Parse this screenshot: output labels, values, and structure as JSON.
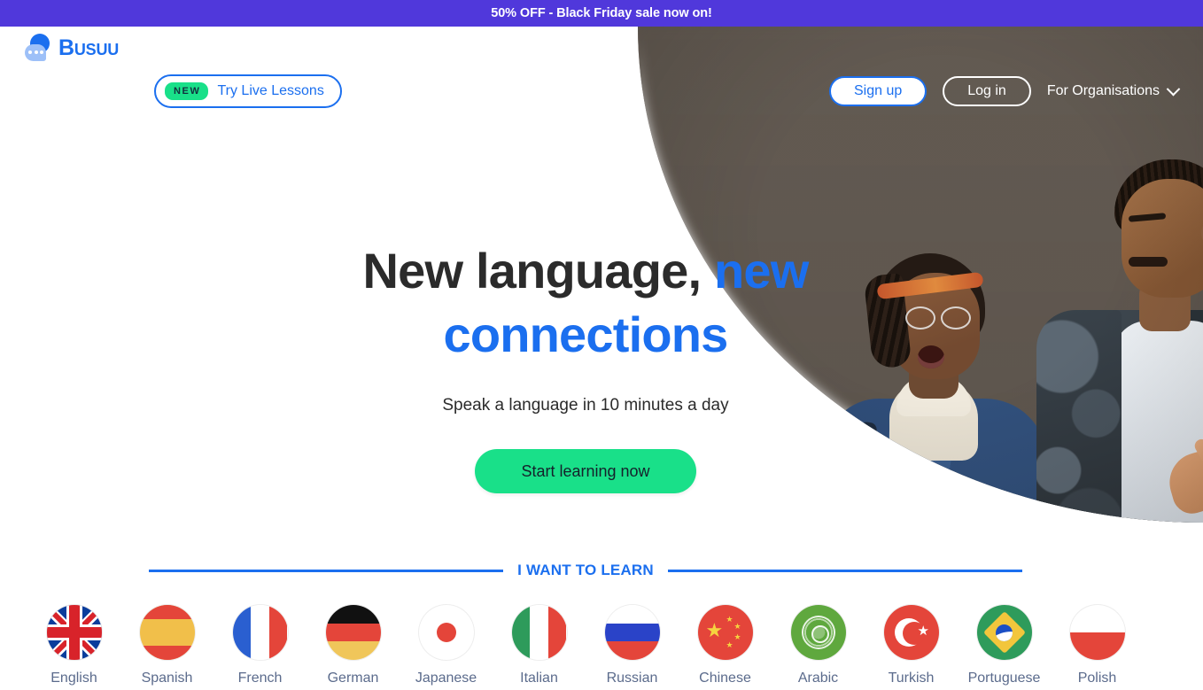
{
  "promo": {
    "text": "50% OFF - Black Friday sale now on!",
    "background": "#5038DB"
  },
  "header": {
    "brand_name": "Busuu",
    "brand_icon": "busuu-speech-bubble-logo",
    "live_lessons": {
      "badge": "NEW",
      "label": "Try Live Lessons"
    },
    "signup_label": "Sign up",
    "login_label": "Log in",
    "organisations_label": "For Organisations",
    "organisations_icon": "chevron-down-icon"
  },
  "hero": {
    "title_dark": "New language,",
    "title_accent_1": "new",
    "title_accent_2": "connections",
    "subtitle": "Speak a language in 10 minutes a day",
    "cta_label": "Start learning now"
  },
  "learn_section": {
    "divider_label": "I WANT TO LEARN",
    "languages": [
      {
        "label": "English",
        "flag": "flag-uk"
      },
      {
        "label": "Spanish",
        "flag": "flag-spain"
      },
      {
        "label": "French",
        "flag": "flag-france"
      },
      {
        "label": "German",
        "flag": "flag-germany"
      },
      {
        "label": "Japanese",
        "flag": "flag-japan"
      },
      {
        "label": "Italian",
        "flag": "flag-italy"
      },
      {
        "label": "Russian",
        "flag": "flag-russia"
      },
      {
        "label": "Chinese",
        "flag": "flag-china"
      },
      {
        "label": "Arabic",
        "flag": "flag-arab-league"
      },
      {
        "label": "Turkish",
        "flag": "flag-turkey"
      },
      {
        "label": "Portuguese",
        "flag": "flag-brazil"
      },
      {
        "label": "Polish",
        "flag": "flag-poland"
      }
    ]
  },
  "colors": {
    "promo_purple": "#5038DB",
    "brand_blue": "#1B6FEF",
    "cta_green": "#19E089",
    "text_dark": "#2B2B2B",
    "label_slate": "#5B6B8C"
  }
}
